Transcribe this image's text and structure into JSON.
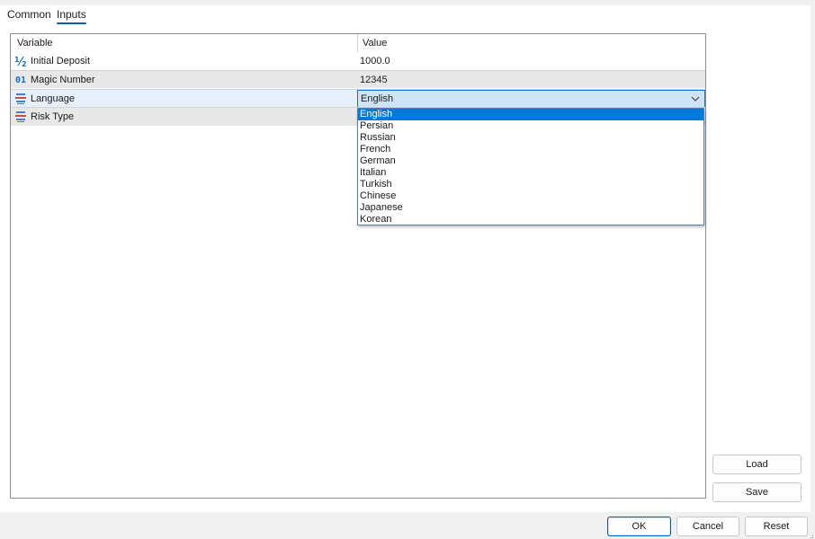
{
  "tabs": [
    {
      "label": "Common"
    },
    {
      "label": "Inputs",
      "active": true
    }
  ],
  "grid": {
    "columns": {
      "variable": "Variable",
      "value": "Value"
    },
    "rows": [
      {
        "icon": "fraction-icon",
        "icon_glyph": "½",
        "name": "Initial Deposit",
        "value": "1000.0"
      },
      {
        "icon": "integer-icon",
        "icon_glyph": "01",
        "name": "Magic Number",
        "value": "12345"
      },
      {
        "icon": "enum-list-icon",
        "name": "Language",
        "value": "English"
      },
      {
        "icon": "enum-list-icon",
        "name": "Risk Type",
        "value": ""
      }
    ]
  },
  "language_dropdown": {
    "selected": "English",
    "options": [
      "English",
      "Persian",
      "Russian",
      "French",
      "German",
      "Italian",
      "Turkish",
      "Chinese",
      "Japanese",
      "Korean"
    ]
  },
  "side_buttons": {
    "load": "Load",
    "save": "Save"
  },
  "footer": {
    "ok": "OK",
    "cancel": "Cancel",
    "reset": "Reset"
  },
  "colors": {
    "accent": "#005fb8",
    "selected_option_bg": "#0078d7",
    "combo_bg": "#cde4f7",
    "alt_row_bg": "#e8e8e8"
  }
}
